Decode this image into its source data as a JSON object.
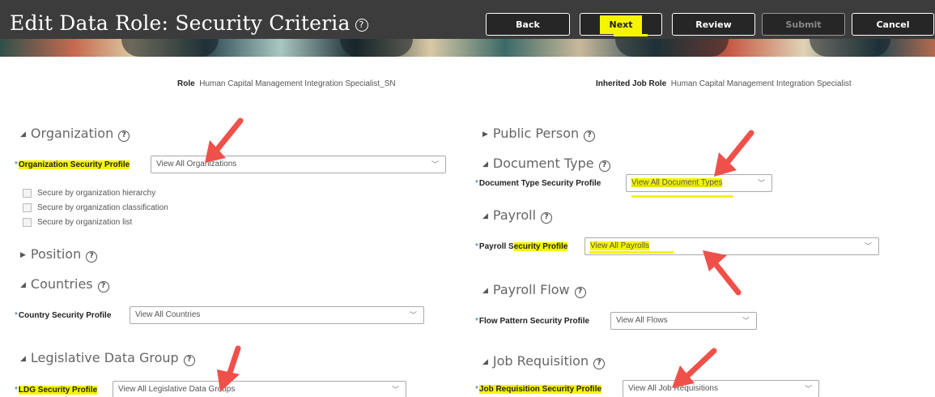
{
  "header": {
    "title": "Edit Data Role: Security Criteria",
    "help_glyph": "?",
    "buttons": {
      "back": "Back",
      "next": "Next",
      "review": "Review",
      "submit": "Submit",
      "cancel": "Cancel"
    }
  },
  "role": {
    "label": "Role",
    "value": "Human Capital Management Integration Specialist_SN"
  },
  "inherited": {
    "label": "Inherited Job Role",
    "value": "Human Capital Management Integration Specialist"
  },
  "left": {
    "organization": {
      "title": "Organization",
      "field_label": "Organization Security Profile",
      "value": "View All Organizations",
      "checks": [
        "Secure by organization hierarchy",
        "Secure by organization classification",
        "Secure by organization list"
      ]
    },
    "position": {
      "title": "Position"
    },
    "countries": {
      "title": "Countries",
      "field_label": "Country Security Profile",
      "value": "View All Countries"
    },
    "ldg": {
      "title": "Legislative Data Group",
      "field_label": "LDG Security Profile",
      "value": "View All Legislative Data Groups"
    }
  },
  "right": {
    "public_person": {
      "title": "Public Person"
    },
    "document_type": {
      "title": "Document Type",
      "field_label": "Document Type Security Profile",
      "value": "View All Document Types"
    },
    "payroll": {
      "title": "Payroll",
      "field_label_a": "Payroll S",
      "field_label_b": "ecurity Profile",
      "value": "View All Payrolls"
    },
    "payroll_flow": {
      "title": "Payroll Flow",
      "field_label": "Flow Pattern Security Profile",
      "value": "View All Flows"
    },
    "job_requisition": {
      "title": "Job Requisition",
      "field_label": "Job Requisition Security Profile",
      "value": "View All Job Requisitions"
    }
  },
  "glyphs": {
    "required": "*",
    "expanded": "◢",
    "collapsed": "▶",
    "chevron": "﹀"
  },
  "colors": {
    "highlight": "#f5f500",
    "arrow": "#f0504a",
    "header_bg": "#3c3c3c"
  }
}
